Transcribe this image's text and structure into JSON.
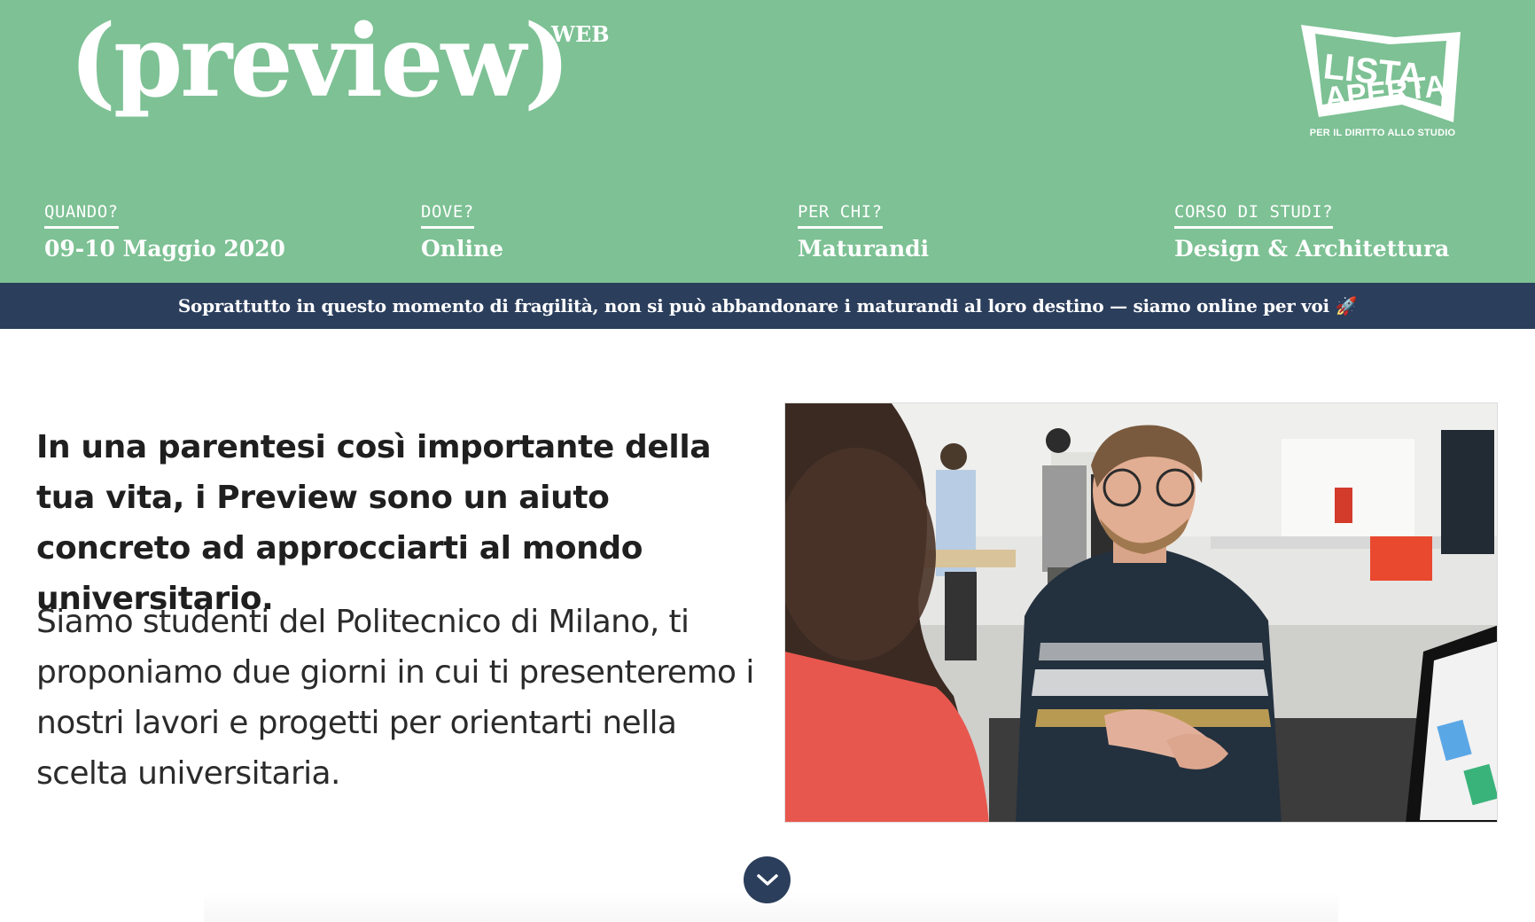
{
  "header": {
    "logo_text": "(preview)",
    "logo_sup": "WEB",
    "badge": {
      "line1": "LISTA",
      "line2": "APERTA",
      "tagline": "PER IL DIRITTO ALLO STUDIO"
    },
    "info": [
      {
        "label": "QUANDO?",
        "value": "09-10 Maggio 2020"
      },
      {
        "label": "DOVE?",
        "value": "Online"
      },
      {
        "label": "PER CHI?",
        "value": "Maturandi"
      },
      {
        "label": "CORSO DI STUDI?",
        "value": "Design & Architettura"
      }
    ]
  },
  "notice": {
    "text": "Soprattutto in questo momento di fragilità, non si può abbandonare i maturandi al loro destino — siamo online per voi 🚀"
  },
  "main": {
    "lead": "In una parentesi così importante della tua vita, i Preview sono un aiuto concreto ad approcciarti al mondo universitario.",
    "body": "Siamo studenti del Politecnico di Milano, ti proponiamo due giorni in cui ti presenteremo i nostri lavori e progetti per orientarti nella scelta universitaria.",
    "scroll_icon": "chevron-down-icon"
  },
  "colors": {
    "header_bg": "#7dc194",
    "notice_bg": "#2b3e5c",
    "button_bg": "#2b3e5c",
    "text_dark": "#1f1f1f"
  }
}
